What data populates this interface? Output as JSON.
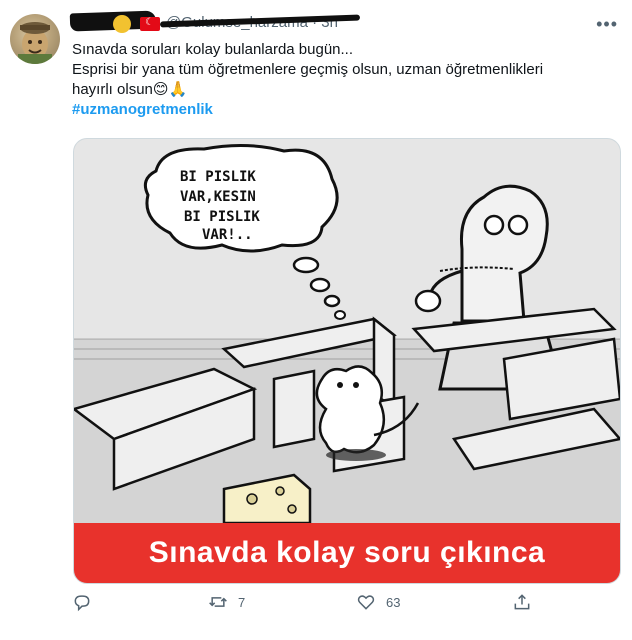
{
  "user": {
    "handle": "@Gulumse_harzama · 3h"
  },
  "tweet": {
    "line1": "Sınavda soruları kolay bulanlarda bugün...",
    "line2": "Esprisi bir yana tüm öğretmenlere geçmiş olsun, uzman öğretmenlikleri",
    "line3": "hayırlı olsun😊🙏",
    "hashtag": "#uzmanogretmenlik"
  },
  "media": {
    "bubble_text": [
      "BI PISLIK",
      "VAR,KESIN",
      "BI PISLIK",
      "VAR!.."
    ],
    "caption": "Sınavda kolay soru çıkınca"
  },
  "actions": {
    "retweets": "7",
    "likes": "63"
  },
  "icons": [
    "more-icon",
    "reply-icon",
    "retweet-icon",
    "like-icon",
    "share-icon"
  ]
}
